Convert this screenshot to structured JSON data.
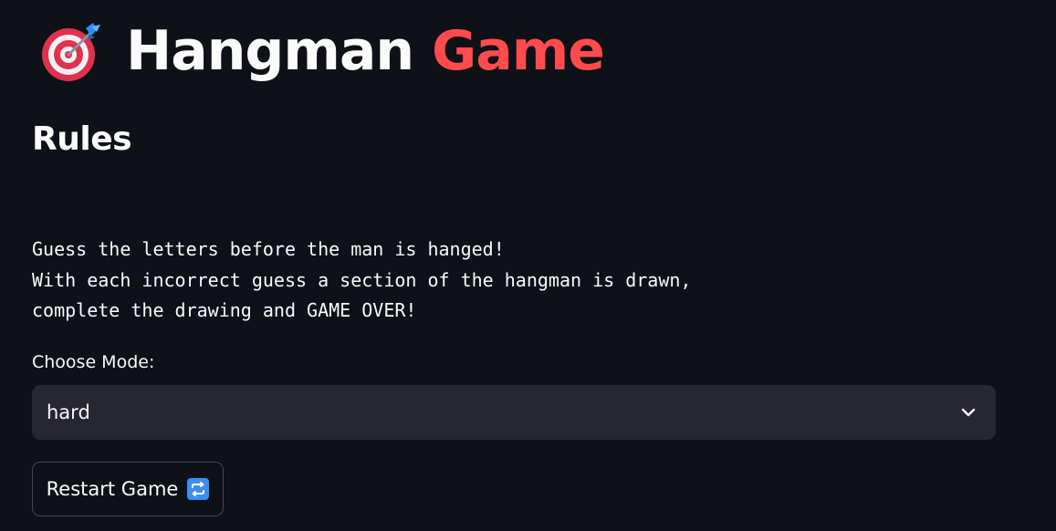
{
  "header": {
    "title_word": "Hangman",
    "title_accent": "Game",
    "icon": "target-dart-icon",
    "accent_color": "#ff4b4b"
  },
  "rules": {
    "heading": "Rules",
    "lines": [
      "Guess the letters before the man is hanged!",
      "With each incorrect guess a section of the hangman is drawn,",
      "complete the drawing and GAME OVER!"
    ]
  },
  "mode": {
    "label": "Choose Mode:",
    "selected": "hard",
    "icon": "chevron-down-icon"
  },
  "restart": {
    "label": "Restart Game",
    "icon": "repeat-icon"
  },
  "colors": {
    "background": "#0e1117",
    "select_bg": "#262730",
    "text": "#fafafa"
  }
}
